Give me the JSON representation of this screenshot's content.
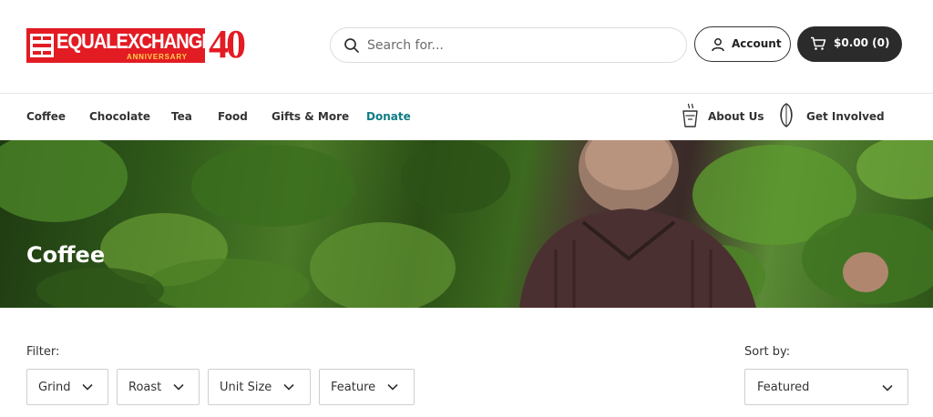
{
  "brand": {
    "logo_text": "EQUALEXCHANGE",
    "logo_subtext": "ANNIVERSARY",
    "anniversary_number": "40",
    "brand_red": "#e31b23"
  },
  "header": {
    "search": {
      "placeholder": "Search for...",
      "value": "",
      "icon": "search-icon"
    },
    "account_label": "Account",
    "cart_label": "$0.00 (0)"
  },
  "nav": {
    "items": [
      {
        "label": "Coffee"
      },
      {
        "label": "Chocolate"
      },
      {
        "label": "Tea"
      },
      {
        "label": "Food"
      },
      {
        "label": "Gifts & More"
      },
      {
        "label": "Donate",
        "color": "#0e7c86"
      }
    ],
    "right": [
      {
        "label": "About Us",
        "icon": "coffee-cup-icon"
      },
      {
        "label": "Get Involved",
        "icon": "cacao-pod-icon"
      }
    ]
  },
  "hero": {
    "title": "Coffee"
  },
  "filters": {
    "label": "Filter:",
    "buttons": [
      {
        "label": "Grind"
      },
      {
        "label": "Roast"
      },
      {
        "label": "Unit Size"
      },
      {
        "label": "Feature"
      }
    ]
  },
  "sort": {
    "label": "Sort by:",
    "selected": "Featured"
  }
}
